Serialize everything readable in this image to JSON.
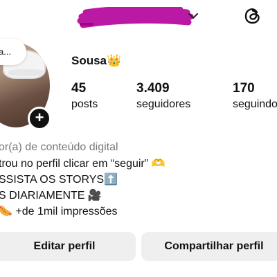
{
  "header": {
    "username_redacted": true,
    "chevron_icon": "chevron-down-icon",
    "threads_icon": "threads-icon",
    "redaction_color": "#b3009a"
  },
  "avatar": {
    "note_text": "a...",
    "add_story_symbol": "+"
  },
  "profile": {
    "display_name": "Sousa👑"
  },
  "stats": [
    {
      "value": "45",
      "label": "posts"
    },
    {
      "value": "3.409",
      "label": "seguidores"
    },
    {
      "value": "170",
      "label": "seguindo"
    }
  ],
  "bio": {
    "category": "or(a) de conteúdo digital",
    "line1": "trou no perfil clicar em “seguir” 🫶",
    "line2": "SSISTA OS STORYS⬆️",
    "line3": "S DIARIAMENTE 🎥",
    "line4": "🌭 +de 1mil impressões"
  },
  "actions": {
    "edit_profile": "Editar perfil",
    "share_profile": "Compartilhar perfil"
  }
}
